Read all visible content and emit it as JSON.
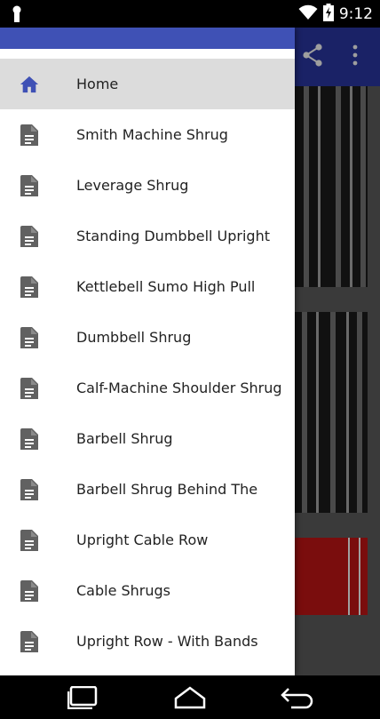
{
  "status_bar": {
    "time": "9:12",
    "icons": [
      "notification-icon",
      "wifi-icon",
      "battery-charging-icon"
    ]
  },
  "app_bar": {
    "actions": [
      "share-icon",
      "more-vert-icon"
    ]
  },
  "drawer": {
    "header_color": "#3f51b5",
    "items": [
      {
        "label": "Home",
        "icon": "home-icon",
        "active": true
      },
      {
        "label": "Smith Machine Shrug",
        "icon": "document-icon"
      },
      {
        "label": "Leverage Shrug",
        "icon": "document-icon"
      },
      {
        "label": "Standing Dumbbell Upright",
        "icon": "document-icon"
      },
      {
        "label": "Kettlebell Sumo High Pull",
        "icon": "document-icon"
      },
      {
        "label": "Dumbbell Shrug",
        "icon": "document-icon"
      },
      {
        "label": "Calf-Machine Shoulder Shrug",
        "icon": "document-icon"
      },
      {
        "label": "Barbell Shrug",
        "icon": "document-icon"
      },
      {
        "label": "Barbell Shrug Behind The",
        "icon": "document-icon"
      },
      {
        "label": "Upright Cable Row",
        "icon": "document-icon"
      },
      {
        "label": "Cable Shrugs",
        "icon": "document-icon"
      },
      {
        "label": "Upright Row - With Bands",
        "icon": "document-icon"
      }
    ]
  },
  "nav_bar": {
    "buttons": [
      "recents-icon",
      "home-nav-icon",
      "back-icon"
    ]
  },
  "colors": {
    "primary": "#3f51b5",
    "primary_dark": "#1a2266",
    "active_item_bg": "#dcdcdc",
    "icon_gray": "#616161"
  }
}
